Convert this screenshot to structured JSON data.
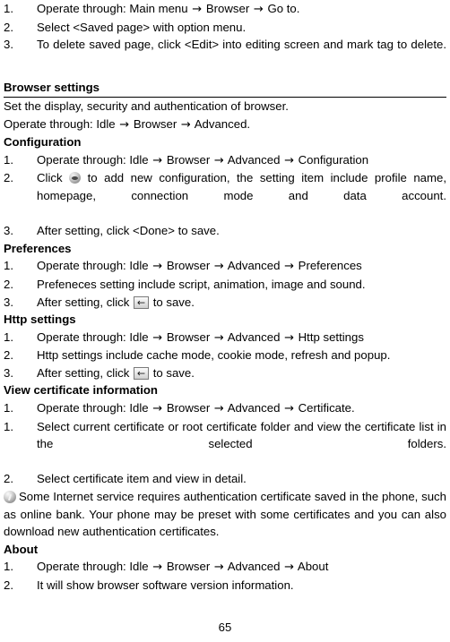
{
  "page": {
    "number": "65"
  },
  "icons": {
    "arrow": "→",
    "back_arrow": "←",
    "sphere_icon_name": "add-configuration-icon",
    "back_icon_name": "back-key-icon",
    "info_icon_name": "info-note-icon"
  },
  "saved_page_steps": [
    {
      "num": "1.",
      "parts": [
        "Operate through: Main menu ",
        " Browser ",
        " Go to."
      ]
    },
    {
      "num": "2.",
      "text": "Select <Saved page> with option menu."
    },
    {
      "num": "3.",
      "text": "To delete saved page, click <Edit> into editing screen and mark tag to delete."
    }
  ],
  "browser_settings": {
    "heading": "Browser settings",
    "intro_line1": "Set the display, security and authentication of browser.",
    "intro_line2_parts": [
      "Operate through: Idle ",
      " Browser ",
      " Advanced."
    ],
    "configuration": {
      "heading": "Configuration",
      "step1_parts": [
        "Operate through: Idle ",
        " Browser ",
        " Advanced ",
        " Configuration"
      ],
      "step2_before": "Click",
      "step2_after": "to add new configuration, the setting item include profile name, homepage, connection mode and data account.",
      "step3": "After setting, click <Done> to save.",
      "nums": [
        "1.",
        "2.",
        "3."
      ]
    },
    "preferences": {
      "heading": "Preferences",
      "step1_parts": [
        "Operate through: Idle ",
        " Browser ",
        " Advanced ",
        " Preferences"
      ],
      "step2": "Prefeneces setting include script, animation, image and sound.",
      "step3_before": "After setting, click",
      "step3_after": "to save.",
      "nums": [
        "1.",
        "2.",
        "3."
      ]
    },
    "http_settings": {
      "heading": "Http settings",
      "step1_parts": [
        "Operate through: Idle ",
        " Browser ",
        " Advanced ",
        " Http settings"
      ],
      "step2": "Http settings include cache mode, cookie mode, refresh and popup.",
      "step3_before": "After setting, click",
      "step3_after": "to save.",
      "nums": [
        "1.",
        "2.",
        "3."
      ]
    },
    "certificate": {
      "heading": "View certificate information",
      "step1_parts": [
        "Operate through: Idle ",
        " Browser ",
        " Advanced ",
        " Certificate."
      ],
      "step2": "Select current certificate or root certificate folder and view the certificate list in the selected folders.",
      "step3": "Select certificate item and view in detail.",
      "nums": [
        "1.",
        "1.",
        "2."
      ],
      "note": "Some Internet service requires authentication certificate saved in the phone, such as online bank. Your phone may be preset with some certificates and you can also download new authentication certificates."
    },
    "about": {
      "heading": "About",
      "step1_parts": [
        "Operate through: Idle ",
        " Browser ",
        " Advanced ",
        " About"
      ],
      "step2": "It will show browser software version information.",
      "nums": [
        "1.",
        "2."
      ]
    }
  }
}
